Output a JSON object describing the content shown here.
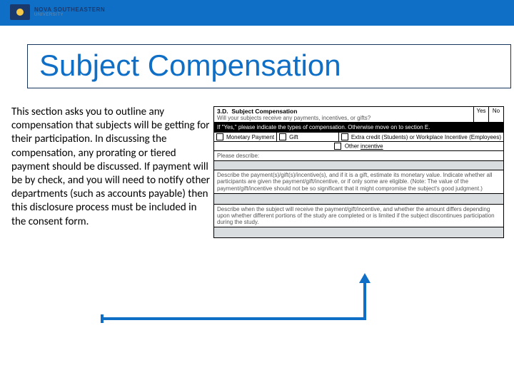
{
  "brand": {
    "line1": "NOVA SOUTHEASTERN",
    "line2": "UNIVERSITY"
  },
  "title": "Subject Compensation",
  "body": "This section asks you to outline any compensation that subjects will be getting for their participation. In discussing the compensation, any prorating or tiered payment should be discussed. If payment will be by check, and you will need to notify other departments (such as accounts payable) then this disclosure process must be included in the consent form.",
  "form": {
    "section_num": "3.D.",
    "section_title": "Subject Compensation",
    "q_receive": "Will your subjects receive any payments, incentives, or gifts?",
    "yes": "Yes",
    "no": "No",
    "if_yes": "If \"Yes,\" please indicate the types of compensation. Otherwise move on to section E.",
    "opt_monetary": "Monetary Payment",
    "opt_gift": "Gift",
    "opt_extra": "Extra credit (Students) or Workplace Incentive (Employees)",
    "other_label": "Other ",
    "other_field": "incentive",
    "please_describe": "Please describe:",
    "describe_payment": "Describe the payment(s)/gift(s)/incentive(s), and if it is a gift, estimate its monetary value.  Indicate whether all participants are given the payment/gift/incentive, or if only some are eligible. (Note: The value of the payment/gift/incentive should not be so significant that it might compromise the subject's good judgment.)",
    "describe_when": "Describe when the subject will receive the payment/gift/incentive, and whether the amount differs depending upon whether different portions of the study are completed or is limited if the subject discontinues participation during the study."
  }
}
